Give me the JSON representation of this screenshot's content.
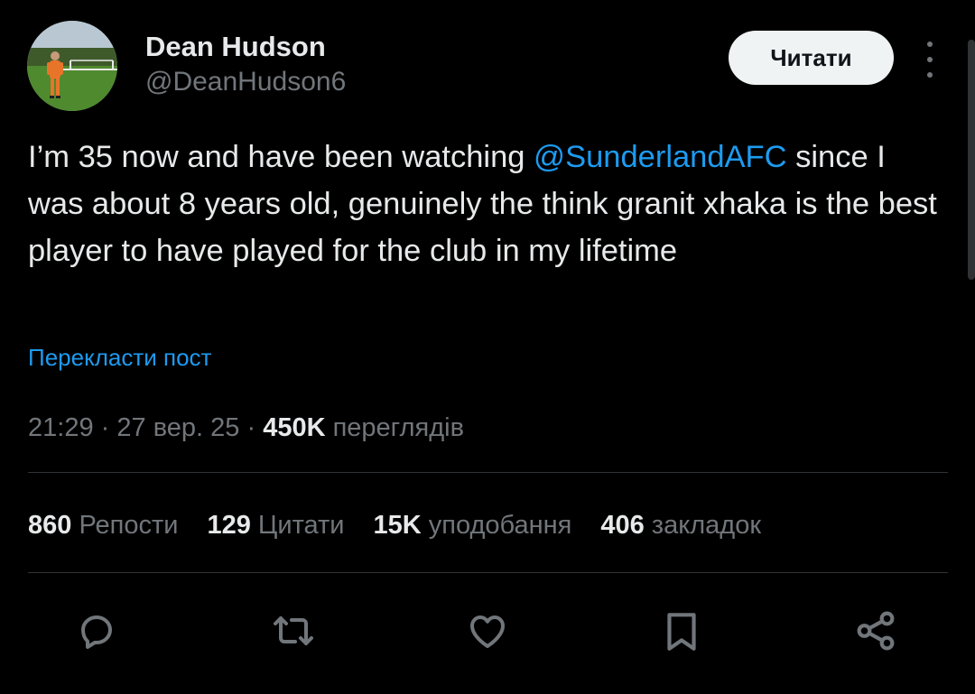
{
  "author": {
    "display_name": "Dean Hudson",
    "handle": "@DeanHudson6"
  },
  "header": {
    "follow_label": "Читати",
    "more_icon": "more-vertical-icon"
  },
  "tweet": {
    "text_before": "I’m 35 now and have been watching ",
    "mention": "@SunderlandAFC",
    "text_after": " since I was about 8 years old, genuinely the think granit xhaka is the best player to have played for the club in my lifetime",
    "translate_label": "Перекласти пост"
  },
  "meta": {
    "time": "21:29",
    "date": "27 вер. 25",
    "separator": "·",
    "views_count": "450K",
    "views_label": "переглядів"
  },
  "stats": {
    "reposts_count": "860",
    "reposts_label": "Репости",
    "quotes_count": "129",
    "quotes_label": "Цитати",
    "likes_count": "15K",
    "likes_label": "уподобання",
    "bookmarks_count": "406",
    "bookmarks_label": "закладок"
  },
  "actions": {
    "reply_icon": "reply-icon",
    "repost_icon": "repost-icon",
    "like_icon": "heart-icon",
    "bookmark_icon": "bookmark-icon",
    "share_icon": "share-icon"
  },
  "colors": {
    "background": "#000000",
    "text_primary": "#e7e9ea",
    "text_secondary": "#71767b",
    "accent": "#1d9bf0",
    "divider": "#2f3336",
    "button_bg": "#eff3f4"
  }
}
